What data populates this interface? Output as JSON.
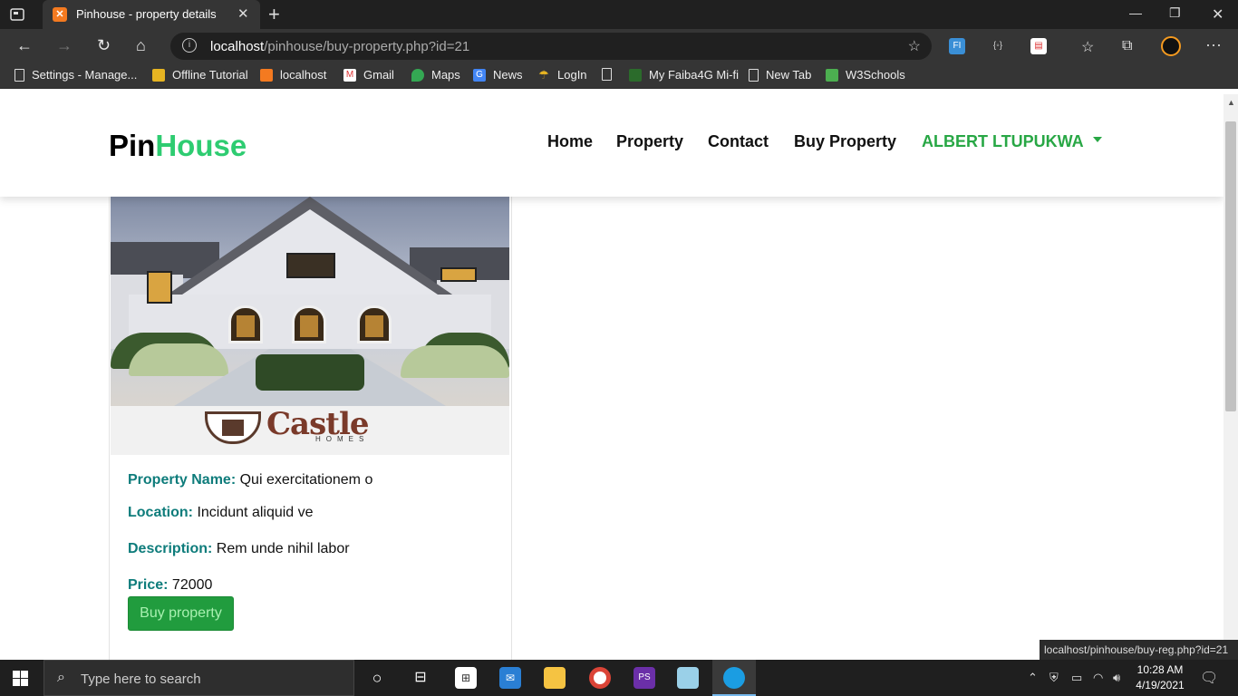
{
  "browser": {
    "tab_title": "Pinhouse - property details",
    "url_host": "localhost",
    "url_path": "/pinhouse/buy-property.php?id=21",
    "bookmarks": [
      {
        "label": "Settings - Manage...",
        "icon": "document-icon"
      },
      {
        "label": "Offline Tutorial",
        "icon": "tutorial-icon"
      },
      {
        "label": "localhost",
        "icon": "xampp-icon"
      },
      {
        "label": "Gmail",
        "icon": "gmail-icon"
      },
      {
        "label": "Maps",
        "icon": "maps-pin-icon"
      },
      {
        "label": "News",
        "icon": "news-icon"
      },
      {
        "label": "LogIn",
        "icon": "login-icon"
      },
      {
        "label": "",
        "icon": "document-icon"
      },
      {
        "label": "My Faiba4G Mi-fi",
        "icon": "faiba-icon"
      },
      {
        "label": "New Tab",
        "icon": "document-icon"
      },
      {
        "label": "W3Schools",
        "icon": "w3schools-icon"
      }
    ],
    "status_url": "localhost/pinhouse/buy-reg.php?id=21"
  },
  "site": {
    "logo_part1": "Pin",
    "logo_part2": "House",
    "nav": [
      "Home",
      "Property",
      "Contact",
      "Buy Property"
    ],
    "user_name": "ALBERT LTUPUKWA",
    "colors": {
      "accent": "#2ecc71",
      "user": "#28a745",
      "label": "#0e7c7b",
      "button": "#219c3e"
    }
  },
  "property": {
    "image_brand": "Castle",
    "image_brand_sub": "HOMES",
    "name_label": "Property Name:",
    "name_value": "Qui exercitationem o",
    "location_label": "Location:",
    "location_value": "Incidunt aliquid ve",
    "description_label": "Description:",
    "description_value": "Rem unde nihil labor",
    "price_label": "Price:",
    "price_value": "72000",
    "buy_button": "Buy property"
  },
  "taskbar": {
    "search_placeholder": "Type here to search",
    "time": "10:28 AM",
    "date": "4/19/2021"
  }
}
